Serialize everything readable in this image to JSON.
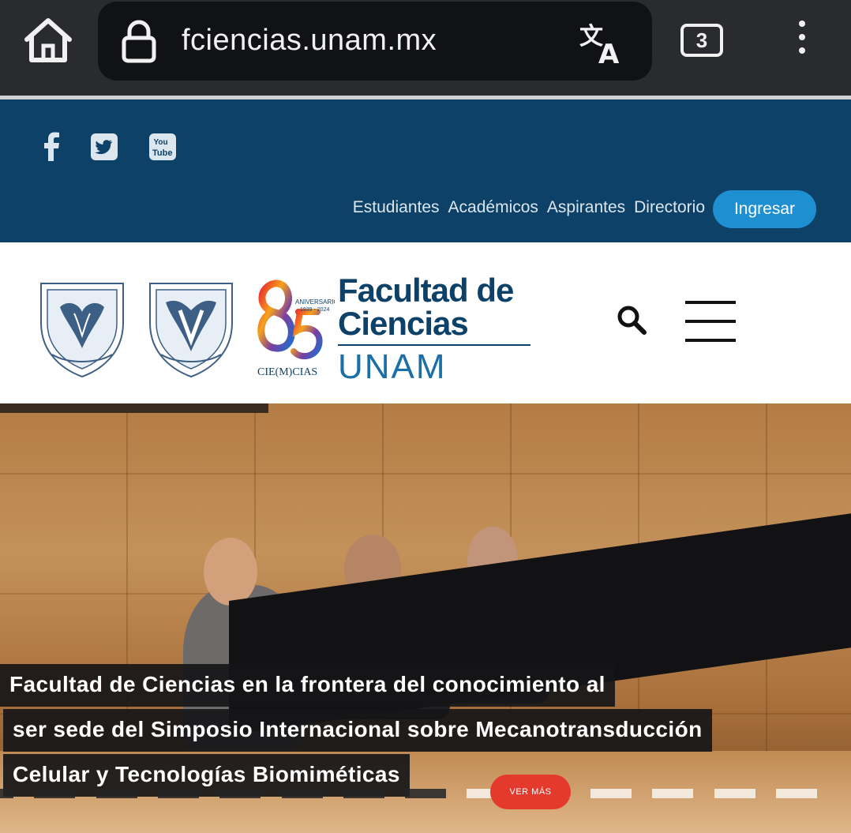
{
  "browser": {
    "url": "fciencias.unam.mx",
    "tab_count": "3"
  },
  "site": {
    "social": [
      "facebook-icon",
      "twitter-icon",
      "youtube-icon"
    ],
    "nav": [
      "Estudiantes",
      "Académicos",
      "Aspirantes",
      "Directorio"
    ],
    "login_label": "Ingresar",
    "title_line1": "Facultad de",
    "title_line2": "Ciencias",
    "title_unam": "UNAM",
    "anniversary_text": "ANIVERSARIO 1939 - 2024",
    "anniversary_number": "85",
    "anniversary_motto": "CIE(M)CIAS"
  },
  "hero": {
    "headline_line1": "Facultad de Ciencias en la frontera del conocimiento al",
    "headline_line2": "ser sede del Simposio Internacional sobre Mecanotransducción",
    "headline_line3": "Celular y Tecnologías Biomiméticas",
    "cta_label": "VER MÁS",
    "slide_count": 14,
    "active_slide": 1
  },
  "colors": {
    "brand_dark": "#0d4168",
    "brand_button": "#1e8fd1",
    "cta": "#e43a2e"
  }
}
